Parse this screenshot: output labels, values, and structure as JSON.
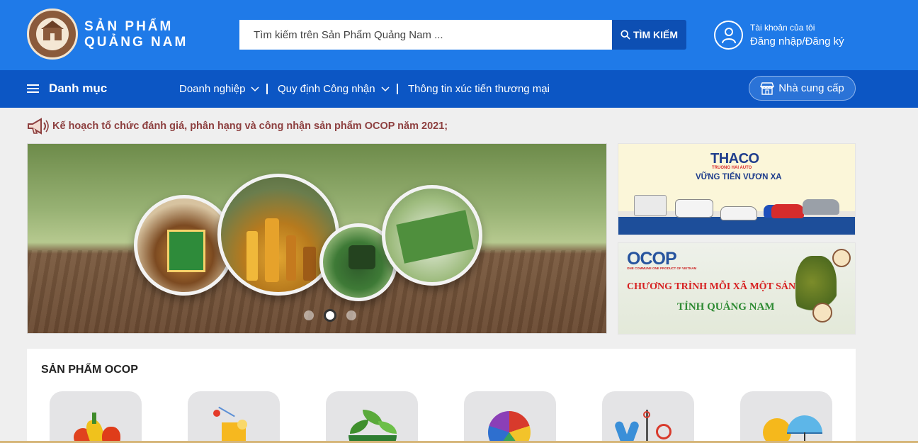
{
  "brand": {
    "line1": "SẢN PHẨM",
    "line2": "QUẢNG NAM",
    "logo_name": "logo-seal-icon"
  },
  "search": {
    "placeholder": "Tìm kiếm trên Sản Phẩm Quảng Nam ...",
    "button_label": "TÌM KIẾM"
  },
  "account": {
    "title": "Tài khoản của tôi",
    "action": "Đăng nhập/Đăng ký"
  },
  "nav": {
    "menu_label": "Danh mục",
    "items": [
      {
        "label": "Doanh nghiệp",
        "has_dropdown": true
      },
      {
        "label": "Quy định Công nhận",
        "has_dropdown": true
      },
      {
        "label": "Thông tin xúc tiến thương mại",
        "has_dropdown": false
      }
    ],
    "supplier_label": "Nhà cung cấp"
  },
  "announcement": {
    "text": "Kế hoạch tổ chức đánh giá, phân hạng và công nhận sản phẩm OCOP năm 2021;"
  },
  "slider": {
    "slides": 3,
    "active_index": 1
  },
  "banners": {
    "thaco": {
      "brand": "THACO",
      "sub": "TRUONG HAI AUTO",
      "slogan": "VỮNG TIẾN VƯƠN XA"
    },
    "ocop": {
      "brand": "OCOP",
      "sub": "ONE COMMUNE ONE PRODUCT OF VIETNAM",
      "line1": "CHƯƠNG TRÌNH MỖI XÃ MỘT SẢN PHẨM",
      "line2": "TỈNH QUẢNG NAM"
    }
  },
  "ocop_section": {
    "title": "SẢN PHẨM OCOP",
    "categories": [
      {
        "icon": "vegetables-icon"
      },
      {
        "icon": "drinks-icon"
      },
      {
        "icon": "herbs-icon"
      },
      {
        "icon": "textile-icon"
      },
      {
        "icon": "handicraft-icon"
      },
      {
        "icon": "tourism-icon"
      }
    ]
  },
  "colors": {
    "header": "#1f7ae8",
    "navbar": "#0c56c4",
    "search_button": "#0d4fb3",
    "announcement": "#8d3f3f",
    "brand_brown": "#8a5a3b"
  }
}
